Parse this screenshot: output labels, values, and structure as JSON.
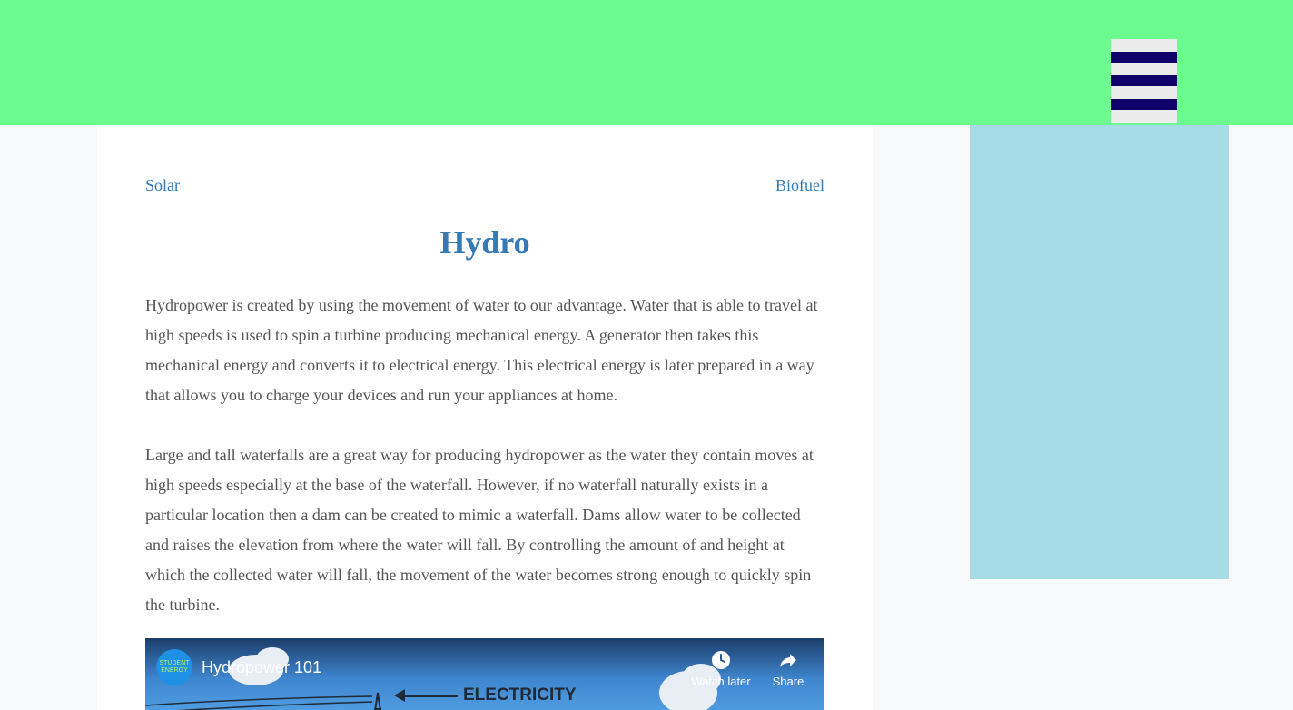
{
  "header": {
    "menu_icon": "hamburger-icon"
  },
  "nav": {
    "prev_label": "Solar",
    "next_label": "Biofuel"
  },
  "article": {
    "title": "Hydro",
    "paragraphs": [
      "Hydropower is created by using the movement of water to our advantage. Water that is able to travel at high speeds is used to spin a turbine producing mechanical energy. A generator then takes this mechanical energy and converts it to electrical energy. This electrical energy is later prepared in a way that allows you to charge your devices and run your appliances at home.",
      "Large and tall waterfalls are a great way for producing hydropower as the water they contain moves at high speeds especially at the base of the waterfall. However, if no waterfall naturally exists in a particular location then a dam can be created to mimic a waterfall. Dams allow water to be collected and raises the elevation from where the water will fall. By controlling the amount of and height at which the collected water will fall, the movement of the water becomes strong enough to quickly spin the turbine."
    ]
  },
  "video": {
    "channel_logo_text": "STUDENT ENERGY",
    "title": "Hydropower 101",
    "watch_later_label": "Watch later",
    "share_label": "Share",
    "thumbnail_text": "ELECTRICITY"
  },
  "colors": {
    "header_bg": "#6cfb8f",
    "menu_bar": "#10006a",
    "sidebar_bg": "#a6dbe8",
    "link": "#337ab7",
    "body_text": "#555555"
  }
}
